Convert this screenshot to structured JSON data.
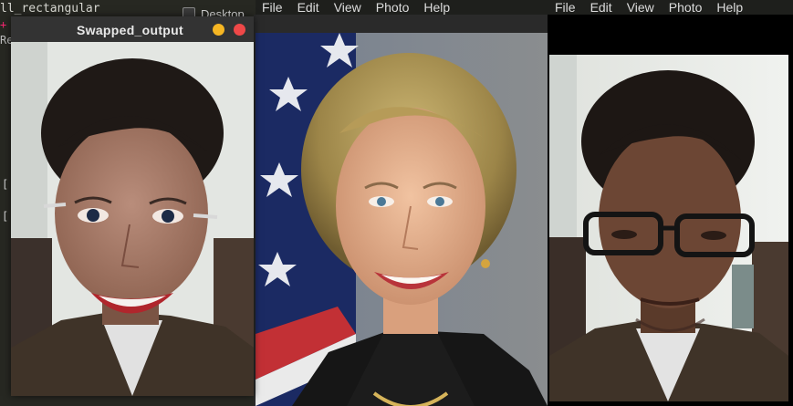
{
  "background": {
    "code_line": "ll_rectangular",
    "plus_mark": "+",
    "re_text": "Re",
    "bracket_glyph": "[",
    "desktop_label": "Desktop"
  },
  "swap_window": {
    "title": "Swapped_output",
    "minimize_color": "#f6b623",
    "close_color": "#ef4848"
  },
  "image_viewer_menu": [
    "File",
    "Edit",
    "View",
    "Photo",
    "Help"
  ],
  "colors": {
    "titlebar": "#333333",
    "editor_bg": "#272822",
    "menu_text": "#dcdcdc"
  }
}
